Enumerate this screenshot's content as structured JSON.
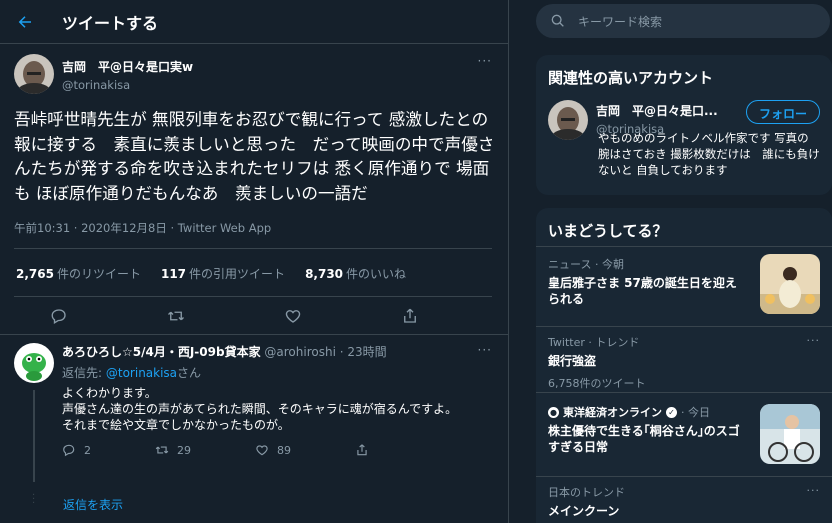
{
  "header": {
    "title": "ツイートする"
  },
  "tweet": {
    "author_name": "吉岡　平@日々是口実w",
    "author_handle": "@torinakisa",
    "text": "吾峠呼世晴先生が 無限列車をお忍びで観に行って 感激したとの報に接する　素直に羨ましいと思った　だって映画の中で声優さんたちが発する命を吹き込まれたセリフは 悉く原作通りで 場面も ほぼ原作通りだもんなあ　羨ましいの一語だ",
    "meta": "午前10:31 · 2020年12月8日 · Twitter Web App",
    "retweets": "2,765",
    "retweets_label": "件のリツイート",
    "quotes": "117",
    "quotes_label": "件の引用ツイート",
    "likes": "8,730",
    "likes_label": "件のいいね",
    "more": "···"
  },
  "reply": {
    "name": "あろひろし☆5/4月・西J-09b貸本家",
    "handle": "@arohiroshi",
    "time": "· 23時間",
    "reply_to_label": "返信先:",
    "reply_to_handle": "@torinakisa",
    "reply_to_suffix": "さん",
    "text": "よくわかります。\n声優さん達の生の声があてられた瞬間、そのキャラに魂が宿るんですよ。\nそれまで絵や文章でしかなかったものが。",
    "reply_count": "2",
    "retweet_count": "29",
    "like_count": "89",
    "more": "···"
  },
  "show_replies": "返信を表示",
  "search": {
    "placeholder": "キーワード検索"
  },
  "related": {
    "title": "関連性の高いアカウント",
    "name": "吉岡　平@日々是口...",
    "handle": "@torinakisa",
    "follow_label": "フォロー",
    "bio": "やものめのライトノベル作家です 写真の腕はさておき 撮影枚数だけは　誰にも負けないと 自負しております"
  },
  "trends": {
    "title": "いまどうしてる？",
    "items": [
      {
        "meta": "ニュース · 今朝",
        "name": "皇后雅子さま 57歳の誕生日を迎えられる"
      },
      {
        "meta": "Twitter · トレンド",
        "name": "銀行強盗",
        "count": "6,758件のツイート",
        "more": "···"
      },
      {
        "meta_source": "東洋経済オンライン",
        "meta_time": "· 今日",
        "name": "株主優待で生きる｢桐谷さん｣のスゴすぎる日常"
      },
      {
        "meta": "日本のトレンド",
        "name": "メインクーン",
        "more": "···"
      }
    ]
  },
  "colors": {
    "background": "#15202b",
    "panel": "#192734",
    "accent": "#1da1f2",
    "muted": "#8899a6",
    "border": "#38444d"
  }
}
